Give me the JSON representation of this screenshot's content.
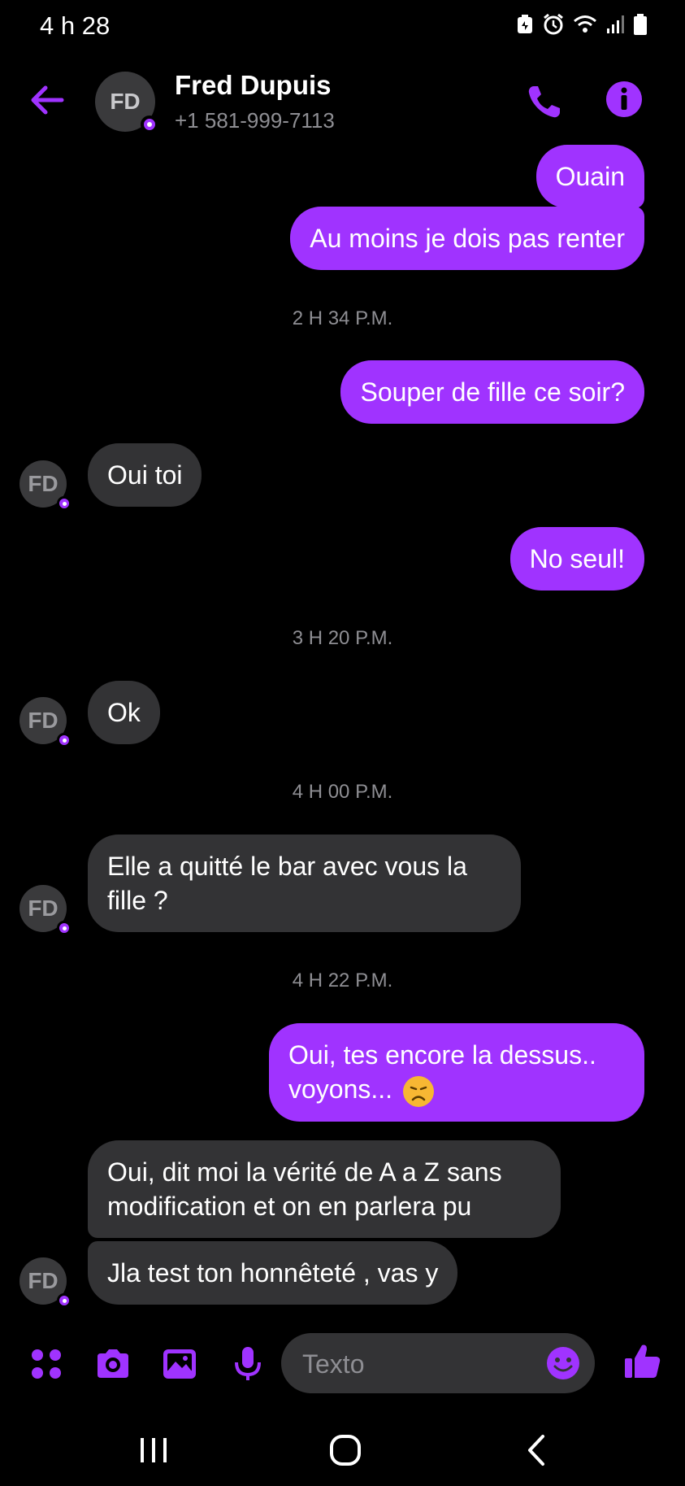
{
  "status_bar": {
    "time": "4 h 28"
  },
  "header": {
    "avatar_initials": "FD",
    "contact_name": "Fred Dupuis",
    "contact_phone": "+1 581-999-7113"
  },
  "messages": [
    {
      "direction": "out",
      "text": "Ouain"
    },
    {
      "direction": "out",
      "text": "Au moins je dois pas renter"
    },
    {
      "timestamp": "2 H 34 P.M."
    },
    {
      "direction": "out",
      "text": "Souper de fille ce soir?"
    },
    {
      "direction": "in",
      "text": "Oui toi"
    },
    {
      "direction": "out",
      "text": "No seul!"
    },
    {
      "timestamp": "3 H 20 P.M."
    },
    {
      "direction": "in",
      "text": "Ok"
    },
    {
      "timestamp": "4 H 00 P.M."
    },
    {
      "direction": "in",
      "text_line1": "Elle a quitté le bar avec vous la",
      "text_line2": "fille ?"
    },
    {
      "timestamp": "4 H 22 P.M."
    },
    {
      "direction": "out",
      "text_line1": "Oui, tes encore la dessus..",
      "text_line2": "voyons...",
      "emoji": "disappointed-face"
    },
    {
      "direction": "in",
      "text_line1": "Oui, dit moi la vérité de A a Z sans",
      "text_line2": "modification et on en parlera pu"
    },
    {
      "direction": "in",
      "text": "Jla test ton honnêteté , vas y"
    }
  ],
  "composer": {
    "placeholder": "Texto"
  },
  "colors": {
    "accent": "#a033ff",
    "incoming_bubble": "#333335",
    "background": "#000000"
  }
}
